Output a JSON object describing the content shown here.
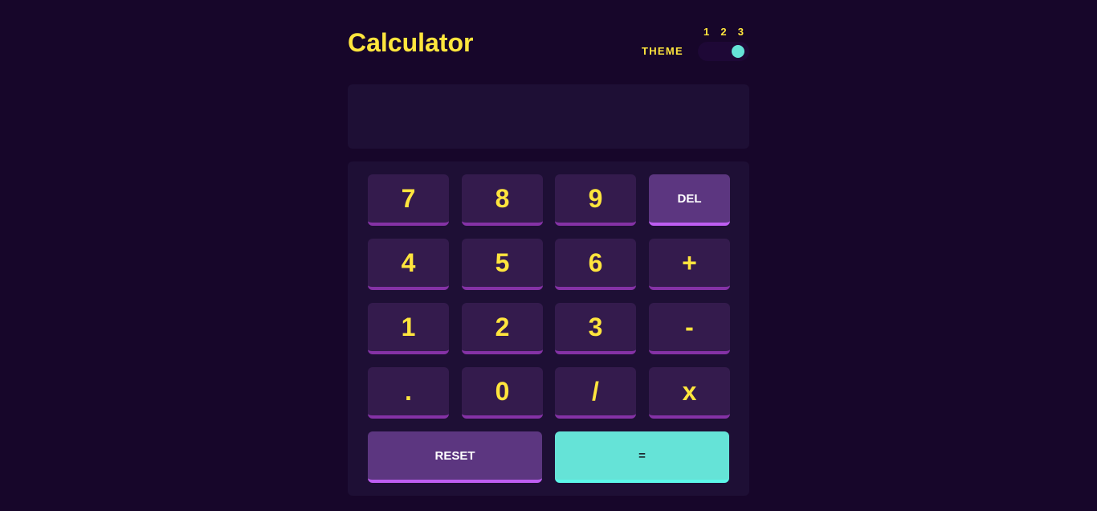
{
  "header": {
    "title": "Calculator",
    "theme_label": "THEME",
    "theme_options": [
      "1",
      "2",
      "3"
    ],
    "selected_theme": "3"
  },
  "display": {
    "value": ""
  },
  "keys": {
    "row1": [
      "7",
      "8",
      "9",
      "DEL"
    ],
    "row2": [
      "4",
      "5",
      "6",
      "+"
    ],
    "row3": [
      "1",
      "2",
      "3",
      "-"
    ],
    "row4": [
      ".",
      "0",
      "/",
      "x"
    ],
    "reset": "RESET",
    "equals": "="
  },
  "colors": {
    "background": "#17062a",
    "panel": "#1e0f35",
    "key": "#341b4d",
    "key_shadow": "#8532a6",
    "accent_key": "#5c3680",
    "accent_shadow": "#be5ef2",
    "equals_key": "#65e3d7",
    "text": "#ffe53d"
  }
}
